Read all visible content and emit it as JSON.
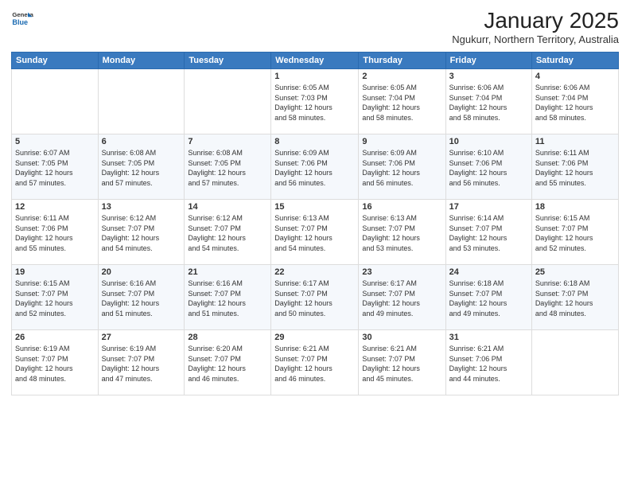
{
  "header": {
    "logo_general": "General",
    "logo_blue": "Blue",
    "month_title": "January 2025",
    "location": "Ngukurr, Northern Territory, Australia"
  },
  "weekdays": [
    "Sunday",
    "Monday",
    "Tuesday",
    "Wednesday",
    "Thursday",
    "Friday",
    "Saturday"
  ],
  "weeks": [
    [
      {
        "day": "",
        "info": ""
      },
      {
        "day": "",
        "info": ""
      },
      {
        "day": "",
        "info": ""
      },
      {
        "day": "1",
        "info": "Sunrise: 6:05 AM\nSunset: 7:03 PM\nDaylight: 12 hours\nand 58 minutes."
      },
      {
        "day": "2",
        "info": "Sunrise: 6:05 AM\nSunset: 7:04 PM\nDaylight: 12 hours\nand 58 minutes."
      },
      {
        "day": "3",
        "info": "Sunrise: 6:06 AM\nSunset: 7:04 PM\nDaylight: 12 hours\nand 58 minutes."
      },
      {
        "day": "4",
        "info": "Sunrise: 6:06 AM\nSunset: 7:04 PM\nDaylight: 12 hours\nand 58 minutes."
      }
    ],
    [
      {
        "day": "5",
        "info": "Sunrise: 6:07 AM\nSunset: 7:05 PM\nDaylight: 12 hours\nand 57 minutes."
      },
      {
        "day": "6",
        "info": "Sunrise: 6:08 AM\nSunset: 7:05 PM\nDaylight: 12 hours\nand 57 minutes."
      },
      {
        "day": "7",
        "info": "Sunrise: 6:08 AM\nSunset: 7:05 PM\nDaylight: 12 hours\nand 57 minutes."
      },
      {
        "day": "8",
        "info": "Sunrise: 6:09 AM\nSunset: 7:06 PM\nDaylight: 12 hours\nand 56 minutes."
      },
      {
        "day": "9",
        "info": "Sunrise: 6:09 AM\nSunset: 7:06 PM\nDaylight: 12 hours\nand 56 minutes."
      },
      {
        "day": "10",
        "info": "Sunrise: 6:10 AM\nSunset: 7:06 PM\nDaylight: 12 hours\nand 56 minutes."
      },
      {
        "day": "11",
        "info": "Sunrise: 6:11 AM\nSunset: 7:06 PM\nDaylight: 12 hours\nand 55 minutes."
      }
    ],
    [
      {
        "day": "12",
        "info": "Sunrise: 6:11 AM\nSunset: 7:06 PM\nDaylight: 12 hours\nand 55 minutes."
      },
      {
        "day": "13",
        "info": "Sunrise: 6:12 AM\nSunset: 7:07 PM\nDaylight: 12 hours\nand 54 minutes."
      },
      {
        "day": "14",
        "info": "Sunrise: 6:12 AM\nSunset: 7:07 PM\nDaylight: 12 hours\nand 54 minutes."
      },
      {
        "day": "15",
        "info": "Sunrise: 6:13 AM\nSunset: 7:07 PM\nDaylight: 12 hours\nand 54 minutes."
      },
      {
        "day": "16",
        "info": "Sunrise: 6:13 AM\nSunset: 7:07 PM\nDaylight: 12 hours\nand 53 minutes."
      },
      {
        "day": "17",
        "info": "Sunrise: 6:14 AM\nSunset: 7:07 PM\nDaylight: 12 hours\nand 53 minutes."
      },
      {
        "day": "18",
        "info": "Sunrise: 6:15 AM\nSunset: 7:07 PM\nDaylight: 12 hours\nand 52 minutes."
      }
    ],
    [
      {
        "day": "19",
        "info": "Sunrise: 6:15 AM\nSunset: 7:07 PM\nDaylight: 12 hours\nand 52 minutes."
      },
      {
        "day": "20",
        "info": "Sunrise: 6:16 AM\nSunset: 7:07 PM\nDaylight: 12 hours\nand 51 minutes."
      },
      {
        "day": "21",
        "info": "Sunrise: 6:16 AM\nSunset: 7:07 PM\nDaylight: 12 hours\nand 51 minutes."
      },
      {
        "day": "22",
        "info": "Sunrise: 6:17 AM\nSunset: 7:07 PM\nDaylight: 12 hours\nand 50 minutes."
      },
      {
        "day": "23",
        "info": "Sunrise: 6:17 AM\nSunset: 7:07 PM\nDaylight: 12 hours\nand 49 minutes."
      },
      {
        "day": "24",
        "info": "Sunrise: 6:18 AM\nSunset: 7:07 PM\nDaylight: 12 hours\nand 49 minutes."
      },
      {
        "day": "25",
        "info": "Sunrise: 6:18 AM\nSunset: 7:07 PM\nDaylight: 12 hours\nand 48 minutes."
      }
    ],
    [
      {
        "day": "26",
        "info": "Sunrise: 6:19 AM\nSunset: 7:07 PM\nDaylight: 12 hours\nand 48 minutes."
      },
      {
        "day": "27",
        "info": "Sunrise: 6:19 AM\nSunset: 7:07 PM\nDaylight: 12 hours\nand 47 minutes."
      },
      {
        "day": "28",
        "info": "Sunrise: 6:20 AM\nSunset: 7:07 PM\nDaylight: 12 hours\nand 46 minutes."
      },
      {
        "day": "29",
        "info": "Sunrise: 6:21 AM\nSunset: 7:07 PM\nDaylight: 12 hours\nand 46 minutes."
      },
      {
        "day": "30",
        "info": "Sunrise: 6:21 AM\nSunset: 7:07 PM\nDaylight: 12 hours\nand 45 minutes."
      },
      {
        "day": "31",
        "info": "Sunrise: 6:21 AM\nSunset: 7:06 PM\nDaylight: 12 hours\nand 44 minutes."
      },
      {
        "day": "",
        "info": ""
      }
    ]
  ]
}
